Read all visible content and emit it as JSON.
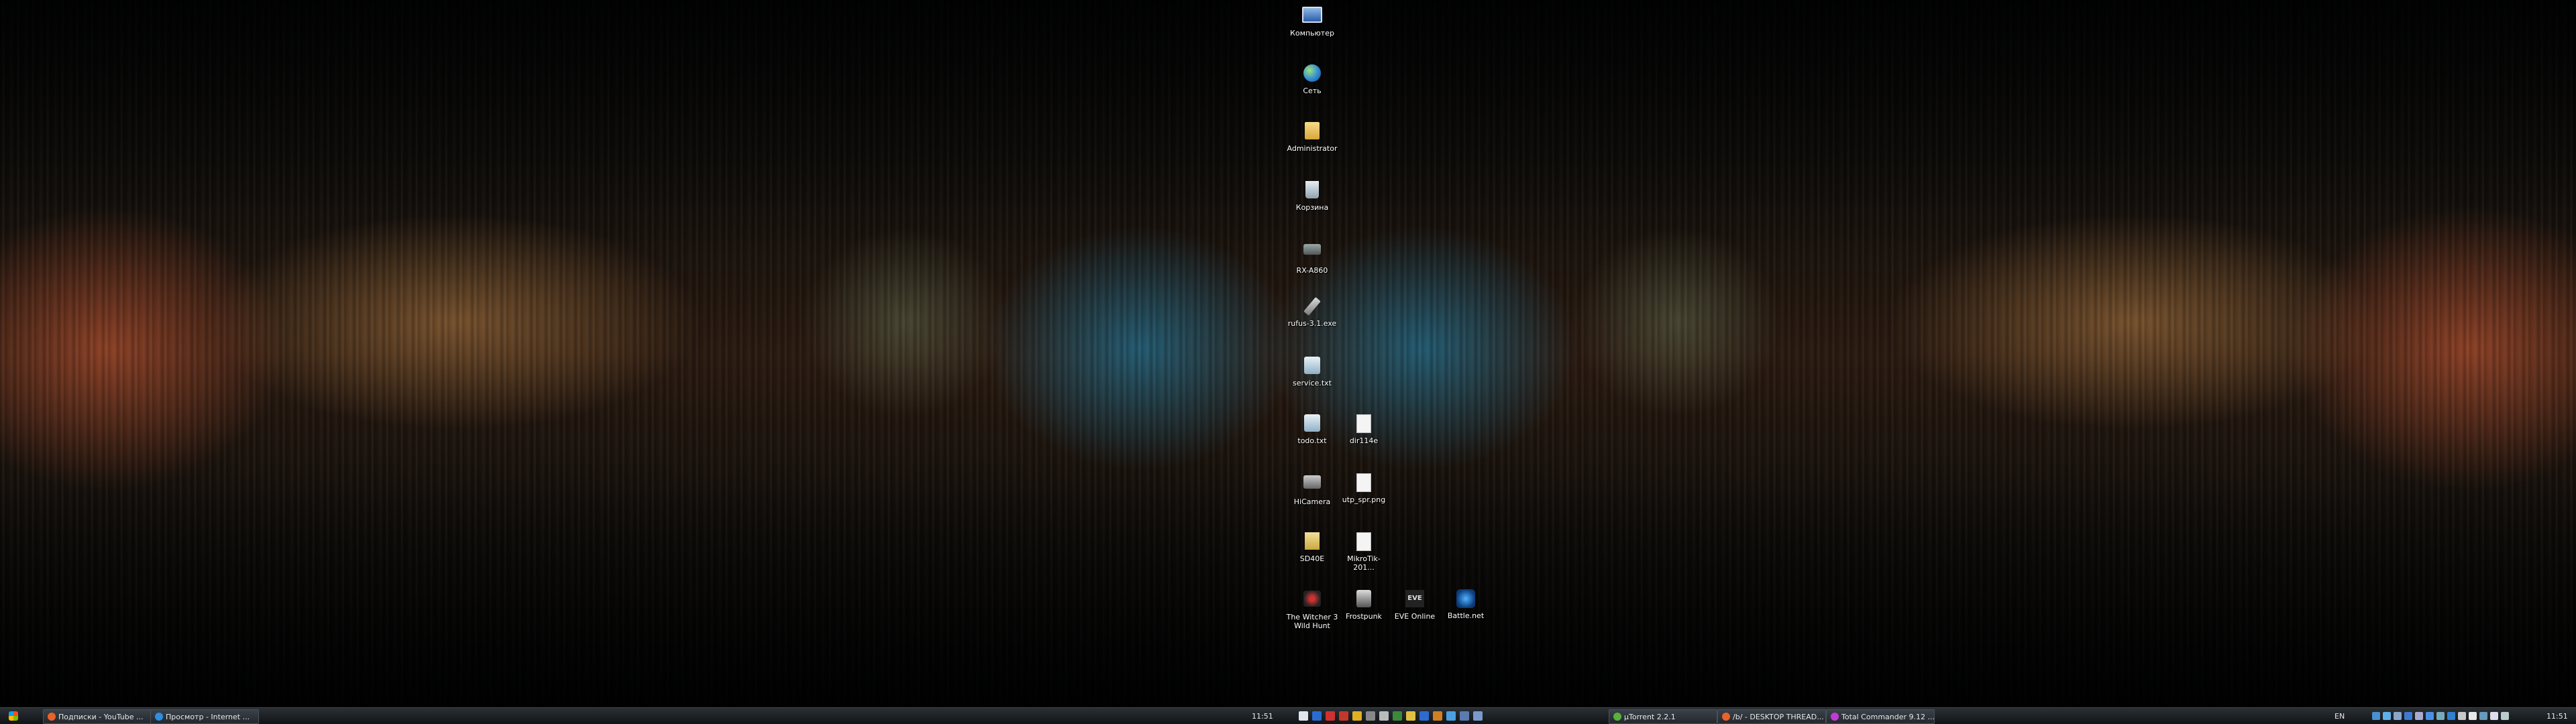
{
  "desktop": {
    "icons": [
      {
        "label": "Компьютер",
        "icon": "computer-icon"
      },
      {
        "label": "Сеть",
        "icon": "network-icon"
      },
      {
        "label": "Administrator",
        "icon": "user-folder-icon"
      },
      {
        "label": "Корзина",
        "icon": "recycle-bin-icon"
      },
      {
        "label": "RX-A860",
        "icon": "receiver-device-icon"
      },
      {
        "label": "rufus-3.1.exe",
        "icon": "usb-drive-icon"
      },
      {
        "label": "service.txt",
        "icon": "text-file-icon"
      },
      {
        "label": "todo.txt",
        "icon": "text-file-icon"
      },
      {
        "label": "dir114e",
        "icon": "document-icon"
      },
      {
        "label": "HiCamera",
        "icon": "camera-icon"
      },
      {
        "label": "utp_spr.png",
        "icon": "image-file-icon"
      },
      {
        "label": "SD40E",
        "icon": "archive-icon"
      },
      {
        "label": "MikroTik-201...",
        "icon": "document-icon"
      },
      {
        "label": "The Witcher 3 Wild Hunt",
        "icon": "witcher-game-icon"
      },
      {
        "label": "Frostpunk",
        "icon": "frostpunk-game-icon"
      },
      {
        "label": "EVE Online",
        "icon": "eve-online-icon"
      },
      {
        "label": "Battle.net",
        "icon": "battlenet-icon"
      }
    ]
  },
  "taskbar": {
    "left_tasks": [
      {
        "label": "Подписки - YouTube ...",
        "icon": "browser-icon",
        "color": "#e8622a"
      },
      {
        "label": "Просмотр - Internet ...",
        "icon": "ie-icon",
        "color": "#2b8fe3"
      }
    ],
    "center_clock": "11:51",
    "eve_badge": "EVE",
    "right_tasks": [
      {
        "label": "µTorrent 2.2.1",
        "icon": "utorrent-icon",
        "color": "#58b23a"
      },
      {
        "label": "/b/ - DESKTOP THREAD...",
        "icon": "browser-icon",
        "color": "#e8622a"
      },
      {
        "label": "Total Commander 9.12 ...",
        "icon": "totalcmd-icon",
        "color": "#c23ad6"
      }
    ],
    "language": "EN",
    "tray_clock": "11:51"
  }
}
